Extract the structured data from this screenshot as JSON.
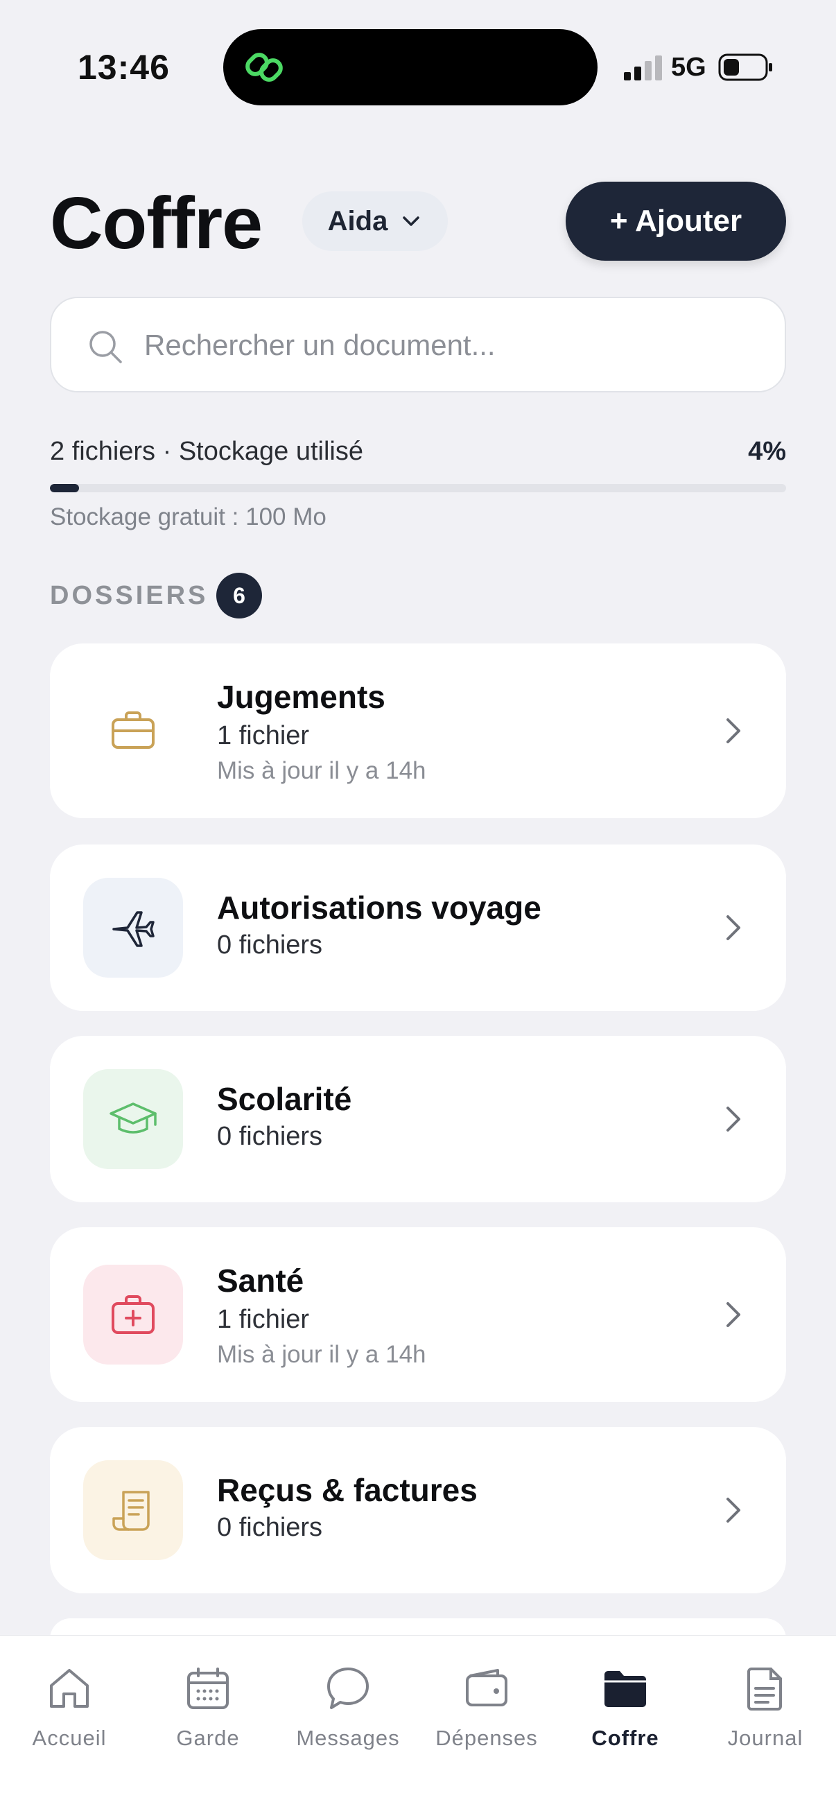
{
  "status_bar": {
    "time": "13:46",
    "network": "5G",
    "signal_icon": "cellular-signal-icon",
    "battery_icon": "battery-icon"
  },
  "header": {
    "title": "Coffre",
    "child_selector": "Aida",
    "add_button": "+ Ajouter"
  },
  "search": {
    "placeholder": "Rechercher un document..."
  },
  "storage": {
    "label": "2 fichiers · Stockage utilisé",
    "percent_label": "4%",
    "used_fraction": 0.04,
    "sub_label": "Stockage gratuit : 100 Mo"
  },
  "section": {
    "title": "DOSSIERS",
    "count": "6"
  },
  "folders": [
    {
      "name": "Jugements",
      "count": "1 fichier",
      "updated": "Mis à jour il y a 14h",
      "icon": "briefcase-icon",
      "icon_color": "#C9A257",
      "icon_bg": "#FBF3E4"
    },
    {
      "name": "Autorisations voyage",
      "count": "0 fichiers",
      "updated": "",
      "icon": "airplane-icon",
      "icon_color": "#1E2638",
      "icon_bg": "#EEF2F8"
    },
    {
      "name": "Scolarité",
      "count": "0 fichiers",
      "updated": "",
      "icon": "graduation-cap-icon",
      "icon_color": "#5DBE6C",
      "icon_bg": "#EAF6EC"
    },
    {
      "name": "Santé",
      "count": "1 fichier",
      "updated": "Mis à jour il y a 14h",
      "icon": "medical-kit-icon",
      "icon_color": "#E04A5E",
      "icon_bg": "#FCE8EC"
    },
    {
      "name": "Reçus & factures",
      "count": "0 fichiers",
      "updated": "",
      "icon": "receipt-icon",
      "icon_color": "#C9A257",
      "icon_bg": "#FBF3E4"
    }
  ],
  "nav": [
    {
      "label": "Accueil",
      "icon": "home-icon"
    },
    {
      "label": "Garde",
      "icon": "calendar-icon"
    },
    {
      "label": "Messages",
      "icon": "chat-bubble-icon"
    },
    {
      "label": "Dépenses",
      "icon": "wallet-icon"
    },
    {
      "label": "Coffre",
      "icon": "folder-icon",
      "active": true
    },
    {
      "label": "Journal",
      "icon": "document-icon"
    }
  ],
  "colors": {
    "background": "#F1F1F5",
    "primary_dark": "#1E2638",
    "muted_text": "#8A8D94"
  }
}
